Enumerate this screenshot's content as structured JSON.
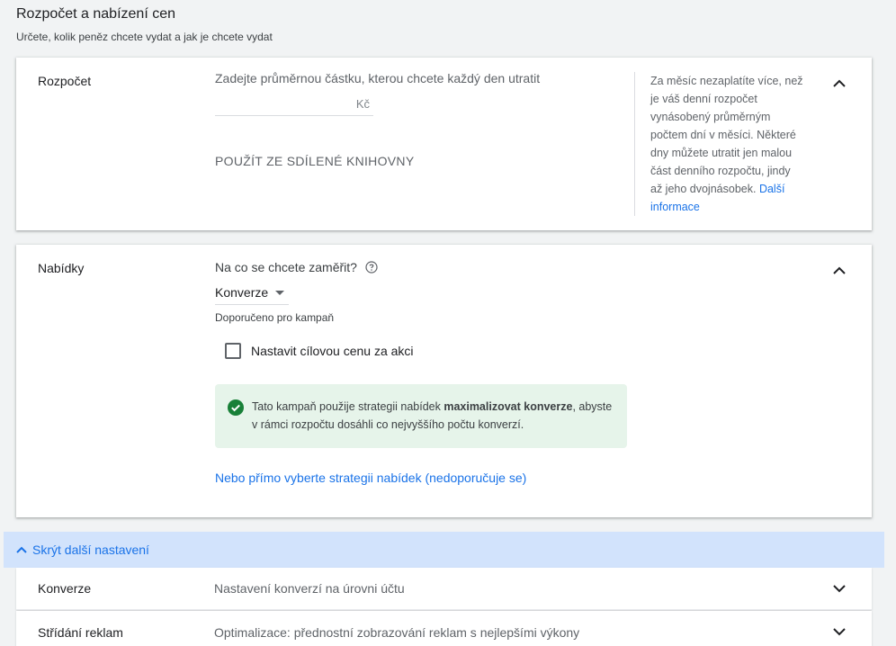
{
  "header": {
    "title": "Rozpočet a nabízení cen",
    "subtitle": "Určete, kolik peněz chcete vydat a jak je chcete vydat"
  },
  "budget": {
    "label": "Rozpočet",
    "field_label": "Zadejte průměrnou částku, kterou chcete každý den utratit",
    "currency": "Kč",
    "input_value": "",
    "shared_library": "POUŽÍT ZE SDÍLENÉ KNIHOVNY",
    "help_text": "Za měsíc nezaplatíte více, než je váš denní rozpočet vynásobený průměrným počtem dní v měsíci. Některé dny můžete utratit jen malou část denního rozpočtu, jindy až jeho dvojnásobek.",
    "help_link": "Další informace"
  },
  "bids": {
    "label": "Nabídky",
    "focus_label": "Na co se chcete zaměřit?",
    "focus_value": "Konverze",
    "recommended": "Doporučeno pro kampaň",
    "checkbox_label": "Nastavit cílovou cenu za akci",
    "info_prefix": "Tato kampaň použije strategii nabídek ",
    "info_bold": "maximalizovat konverze",
    "info_suffix": ", abyste v rámci rozpočtu dosáhli co nejvyššího počtu konverzí.",
    "direct_link": "Nebo přímo vyberte strategii nabídek (nedoporučuje se)"
  },
  "more_settings": {
    "label": "Skrýt další nastavení"
  },
  "rows": [
    {
      "title": "Konverze",
      "desc": "Nastavení konverzí na úrovni účtu"
    },
    {
      "title": "Střídání reklam",
      "desc": "Optimalizace: přednostní zobrazování reklam s nejlepšími výkony"
    }
  ],
  "colors": {
    "accent": "#1a73e8",
    "success": "#188038",
    "info_bg": "#e6f4ea",
    "more_bar_bg": "#d2e3fc"
  },
  "icons": [
    "chevron-up-icon",
    "help-circle-icon",
    "check-circle-icon",
    "chevron-down-icon"
  ]
}
